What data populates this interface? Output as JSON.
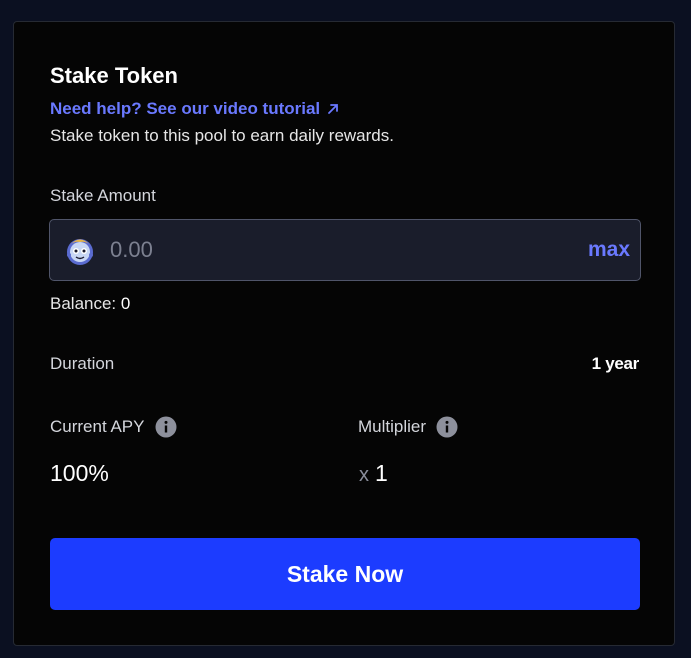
{
  "card": {
    "title": "Stake Token",
    "help_link": "Need help? See our video tutorial",
    "help_icon": "external-link-arrow-icon",
    "subtitle": "Stake token to this pool to earn daily rewards."
  },
  "stake": {
    "label": "Stake Amount",
    "placeholder": "0.00",
    "value": "",
    "max_label": "max",
    "token_icon": "token-avatar-icon"
  },
  "balance": {
    "label": "Balance:",
    "value": "0"
  },
  "duration": {
    "label": "Duration",
    "value": "1 year"
  },
  "apy": {
    "label": "Current APY",
    "value": "100%",
    "icon": "info-icon"
  },
  "multiplier": {
    "label": "Multiplier",
    "prefix": "x",
    "value": "1",
    "icon": "info-icon"
  },
  "action": {
    "label": "Stake Now"
  },
  "colors": {
    "page_bg": "#0b1021",
    "card_bg": "#050505",
    "accent": "#6a79ff",
    "button": "#1c3cff",
    "input_bg": "#1a1d2b"
  }
}
